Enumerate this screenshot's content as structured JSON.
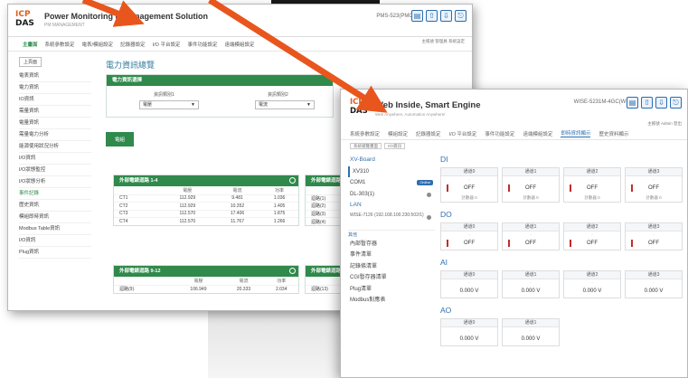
{
  "win1": {
    "title": "Power Monitoring & Management Solution",
    "subtitle": "PM MANAGEMENT",
    "device_tag": "PMS-523(PMC5)",
    "account_text": "主帳號 管理員 系統設定",
    "nav": [
      "主畫面",
      "系統參數設定",
      "電表/模組設定",
      "記錄器設定",
      "I/O 平台設定",
      "事件功能設定",
      "遠端模組設定"
    ],
    "nav_active_index": 0,
    "side_button": "上頁面",
    "side_items": [
      "電表資訊",
      "電力資訊",
      "IO資訊",
      "需量資訊",
      "電量資訊",
      "需量電力分析",
      "能源使用狀況分析",
      "I/O資訊",
      "I/O狀態監控",
      "I/O狀態分析",
      "事件記錄",
      "歷史資訊",
      "模組即時資訊",
      "Modbus Table資訊",
      "I/O資訊",
      "Plug資訊"
    ],
    "side_active_index": 10,
    "page_title": "電力資訊總覽",
    "select_panel": {
      "title": "電力資訊選擇",
      "label1": "資訊類別1",
      "label2": "資訊類別2",
      "value1": "電壓",
      "value2": "電流"
    },
    "button": "電組",
    "ct_panels": [
      {
        "title": "外部電錶迴路 1-4",
        "columns": [
          "",
          "電壓",
          "電流",
          "功率"
        ],
        "rows": [
          [
            "CT1",
            "112.929",
            "9.481",
            "1.036"
          ],
          [
            "CT2",
            "112.929",
            "10.352",
            "1.405"
          ],
          [
            "CT3",
            "112.570",
            "17.406",
            "1.875"
          ],
          [
            "CT4",
            "112.570",
            "11.767",
            "1.266"
          ]
        ]
      },
      {
        "title": "外部電錶迴路",
        "columns": [
          "",
          ""
        ],
        "rows": [
          [
            "迴路(1)"
          ],
          [
            "迴路(2)"
          ],
          [
            "迴路(3)"
          ],
          [
            "迴路(4)"
          ]
        ]
      },
      {
        "title": "外部電錶迴路 9-12",
        "columns": [
          "",
          "電壓",
          "電流",
          "功率"
        ],
        "rows": [
          [
            "迴路(9)",
            "106.949",
            "20.333",
            "2.034"
          ]
        ]
      },
      {
        "title": "外部電錶迴路",
        "columns": [
          "",
          ""
        ],
        "rows": [
          [
            "迴路(13)"
          ]
        ]
      }
    ]
  },
  "win2": {
    "title": "Web Inside, Smart Engine",
    "subtitle": "Web Anywhere, Automation Anywhere!",
    "device_tag": "WISE-5231M-4GC(WISE)",
    "account_text": "主帳號  Admin  登出",
    "nav": [
      "系統參數設定",
      "模組設定",
      "記錄器設定",
      "I/O 平台設定",
      "事件功能設定",
      "遠端模組設定",
      "即時資訊顯示",
      "歷史資料顯示"
    ],
    "nav_active_index": 6,
    "crumbs": [
      "系統總覽畫面",
      "I/O資訊"
    ],
    "side_items": [
      {
        "label": "XV-Board",
        "kind": "head"
      },
      {
        "label": "XV310",
        "kind": "sel"
      },
      {
        "label": "COM1",
        "kind": "badge",
        "badge": "Online"
      },
      {
        "label": "DL-303(1)",
        "kind": "dot"
      },
      {
        "label": "LAN",
        "kind": "head"
      },
      {
        "label": "WISE-7126 (192.168.100.230:502/1)",
        "kind": "tall-dot"
      },
      {
        "label": "其他",
        "kind": "sect"
      },
      {
        "label": "內部暫存器",
        "kind": "plain"
      },
      {
        "label": "事件清單",
        "kind": "plain"
      },
      {
        "label": "記錄條清單",
        "kind": "plain"
      },
      {
        "label": "CGI暫存器清單",
        "kind": "plain"
      },
      {
        "label": "Plug清單",
        "kind": "plain"
      },
      {
        "label": "Modbus對應表",
        "kind": "plain"
      }
    ],
    "di": {
      "title": "DI",
      "cards": [
        {
          "head": "通道0",
          "state": "OFF",
          "counter": "計數器 0"
        },
        {
          "head": "通道1",
          "state": "OFF",
          "counter": "計數器 0"
        },
        {
          "head": "通道2",
          "state": "OFF",
          "counter": "計數器 0"
        },
        {
          "head": "通道3",
          "state": "OFF",
          "counter": "計數器 0"
        }
      ]
    },
    "do": {
      "title": "DO",
      "cards": [
        {
          "head": "通道0",
          "state": "OFF"
        },
        {
          "head": "通道1",
          "state": "OFF"
        },
        {
          "head": "通道2",
          "state": "OFF"
        },
        {
          "head": "通道3",
          "state": "OFF"
        }
      ]
    },
    "ai": {
      "title": "AI",
      "cards": [
        {
          "head": "通道0",
          "value": "0.000 V"
        },
        {
          "head": "通道1",
          "value": "0.000 V"
        },
        {
          "head": "通道2",
          "value": "0.000 V"
        },
        {
          "head": "通道3",
          "value": "0.000 V"
        }
      ]
    },
    "ao": {
      "title": "AO",
      "cards": [
        {
          "head": "通道0",
          "value": "0.000 V"
        },
        {
          "head": "通道1",
          "value": "0.000 V"
        }
      ]
    }
  },
  "logo": {
    "line1": "ICP",
    "line2": "DAS"
  },
  "colors": {
    "arrow": "#e8561e",
    "green": "#2f8a4b",
    "blue": "#2f6fb0",
    "red": "#c32c2c"
  }
}
